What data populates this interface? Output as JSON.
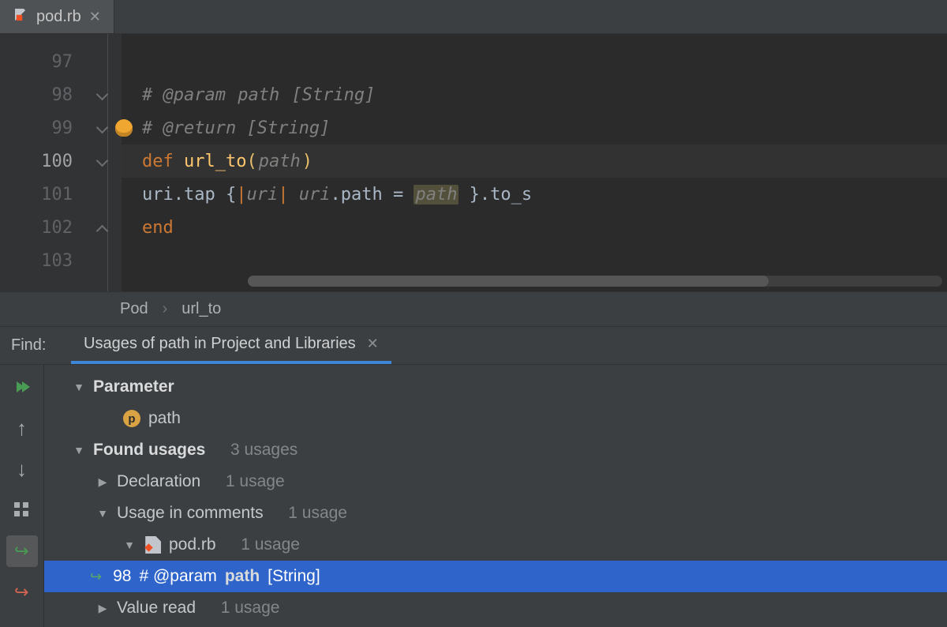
{
  "tab": {
    "filename": "pod.rb"
  },
  "editor": {
    "lines": [
      {
        "num": "97"
      },
      {
        "num": "98"
      },
      {
        "num": "99"
      },
      {
        "num": "100"
      },
      {
        "num": "101"
      },
      {
        "num": "102"
      },
      {
        "num": "103"
      }
    ],
    "l98": {
      "pre": "# @param ",
      "mark": "path",
      "post": " [String]"
    },
    "l99": {
      "text": "# @return [String]"
    },
    "l100": {
      "kw": "def ",
      "fn": "url_to",
      "lp": "(",
      "param": "path",
      "rp": ")"
    },
    "l101": {
      "a": "uri",
      "b": ".tap {",
      "c": "|",
      "d": "uri",
      "e": "| ",
      "f": "uri",
      "g": ".path = ",
      "h": "path",
      "i": " }.to_s"
    },
    "l102": {
      "kw": "end"
    }
  },
  "breadcrumb": {
    "a": "Pod",
    "sep": "›",
    "b": "url_to"
  },
  "find": {
    "label": "Find:",
    "tab_title": "Usages of path in Project and Libraries",
    "tree": {
      "parameter_hdr": "Parameter",
      "param_name": "path",
      "found_hdr": "Found usages",
      "found_count": "3 usages",
      "decl": "Declaration",
      "decl_count": "1 usage",
      "comments": "Usage in comments",
      "comments_count": "1 usage",
      "file": "pod.rb",
      "file_count": "1 usage",
      "hit_linenum": "98",
      "hit_pre": " # @param ",
      "hit_bold": "path",
      "hit_post": " [String]",
      "valread": "Value read",
      "valread_count": "1 usage"
    }
  }
}
